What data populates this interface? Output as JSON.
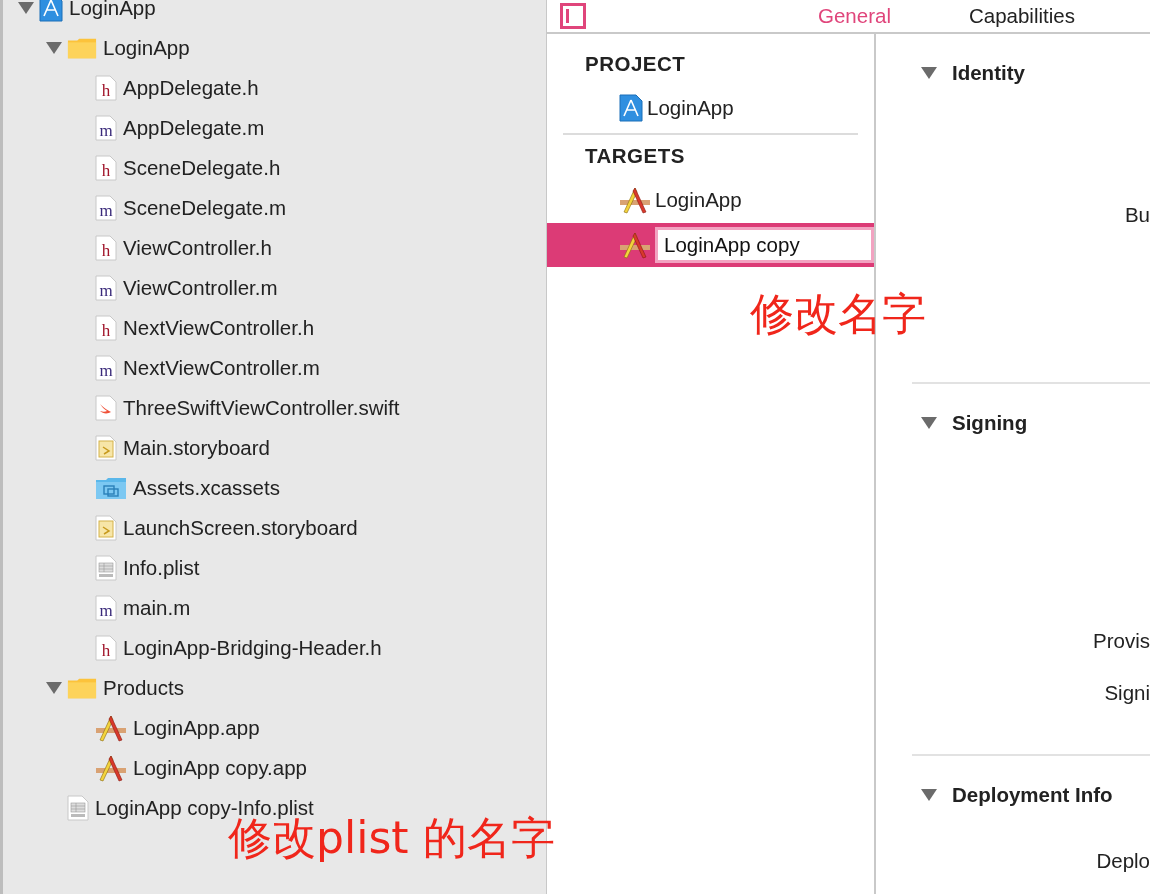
{
  "header": {
    "tabs": [
      {
        "label": "General",
        "selected": true
      },
      {
        "label": "Capabilities",
        "selected": false
      }
    ]
  },
  "navigator": {
    "items": [
      {
        "label": "LoginApp",
        "kind": "project",
        "expanded": true,
        "children": [
          {
            "label": "LoginApp",
            "kind": "folder",
            "expanded": true,
            "children": [
              {
                "label": "AppDelegate.h",
                "kind": "h"
              },
              {
                "label": "AppDelegate.m",
                "kind": "m"
              },
              {
                "label": "SceneDelegate.h",
                "kind": "h"
              },
              {
                "label": "SceneDelegate.m",
                "kind": "m"
              },
              {
                "label": "ViewController.h",
                "kind": "h"
              },
              {
                "label": "ViewController.m",
                "kind": "m"
              },
              {
                "label": "NextViewController.h",
                "kind": "h"
              },
              {
                "label": "NextViewController.m",
                "kind": "m"
              },
              {
                "label": "ThreeSwiftViewController.swift",
                "kind": "swift"
              },
              {
                "label": "Main.storyboard",
                "kind": "storyboard"
              },
              {
                "label": "Assets.xcassets",
                "kind": "assets"
              },
              {
                "label": "LaunchScreen.storyboard",
                "kind": "storyboard"
              },
              {
                "label": "Info.plist",
                "kind": "plist"
              },
              {
                "label": "main.m",
                "kind": "m"
              },
              {
                "label": "LoginApp-Bridging-Header.h",
                "kind": "h"
              }
            ]
          },
          {
            "label": "Products",
            "kind": "folder",
            "expanded": true,
            "children": [
              {
                "label": "LoginApp.app",
                "kind": "app"
              },
              {
                "label": "LoginApp copy.app",
                "kind": "app"
              }
            ]
          },
          {
            "label": "LoginApp copy-Info.plist",
            "kind": "plist"
          }
        ]
      }
    ]
  },
  "targets": {
    "groups": [
      {
        "title": "PROJECT",
        "items": [
          {
            "label": "LoginApp",
            "kind": "project",
            "selected": false,
            "editing": false
          }
        ]
      },
      {
        "title": "TARGETS",
        "items": [
          {
            "label": "LoginApp",
            "kind": "app",
            "selected": false,
            "editing": false
          },
          {
            "label": "LoginApp copy",
            "kind": "app",
            "selected": true,
            "editing": true
          }
        ]
      }
    ]
  },
  "settings": {
    "sections": [
      {
        "title": "Identity",
        "expanded": true,
        "fields": [
          "Bu"
        ]
      },
      {
        "title": "Signing",
        "expanded": true,
        "fields": [
          "Provis",
          "Signi"
        ]
      },
      {
        "title": "Deployment Info",
        "expanded": true,
        "fields": [
          "Deplo"
        ]
      }
    ]
  },
  "annotations": [
    {
      "text": "修改名字"
    },
    {
      "text": "修改plist 的名字"
    }
  ]
}
